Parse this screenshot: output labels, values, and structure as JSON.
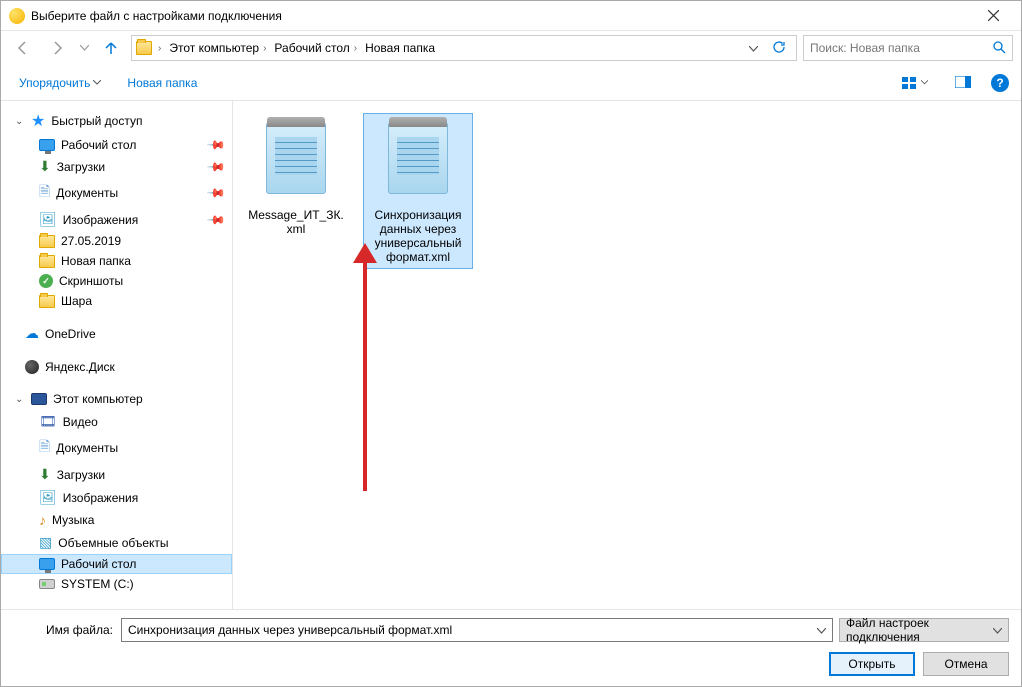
{
  "title": "Выберите файл с настройками подключения",
  "breadcrumbs": [
    "Этот компьютер",
    "Рабочий стол",
    "Новая папка"
  ],
  "search_placeholder": "Поиск: Новая папка",
  "toolbar": {
    "organize": "Упорядочить",
    "new_folder": "Новая папка"
  },
  "sidebar": {
    "quick_access": {
      "label": "Быстрый доступ",
      "items": [
        {
          "label": "Рабочий стол",
          "icon": "monitor",
          "pinned": true
        },
        {
          "label": "Загрузки",
          "icon": "download",
          "pinned": true
        },
        {
          "label": "Документы",
          "icon": "doc",
          "pinned": true
        },
        {
          "label": "Изображения",
          "icon": "image",
          "pinned": true
        },
        {
          "label": "27.05.2019",
          "icon": "folder",
          "pinned": false
        },
        {
          "label": "Новая папка",
          "icon": "folder",
          "pinned": false
        },
        {
          "label": "Скриншоты",
          "icon": "check",
          "pinned": false
        },
        {
          "label": "Шара",
          "icon": "folder",
          "pinned": false
        }
      ]
    },
    "onedrive": "OneDrive",
    "yandex": "Яндекс.Диск",
    "this_pc": {
      "label": "Этот компьютер",
      "items": [
        {
          "label": "Видео",
          "icon": "video"
        },
        {
          "label": "Документы",
          "icon": "doc"
        },
        {
          "label": "Загрузки",
          "icon": "download"
        },
        {
          "label": "Изображения",
          "icon": "image"
        },
        {
          "label": "Музыка",
          "icon": "music"
        },
        {
          "label": "Объемные объекты",
          "icon": "3d"
        },
        {
          "label": "Рабочий стол",
          "icon": "monitor",
          "selected": true
        },
        {
          "label": "SYSTEM (C:)",
          "icon": "disk"
        }
      ]
    }
  },
  "files": [
    {
      "name": "Message_ИТ_ЗК.xml",
      "selected": false
    },
    {
      "name": "Синхронизация данных через универсальный формат.xml",
      "selected": true
    }
  ],
  "filename_label": "Имя файла:",
  "filename_value": "Синхронизация данных через универсальный формат.xml",
  "filter_label": "Файл настроек подключения",
  "open_btn": "Открыть",
  "cancel_btn": "Отмена"
}
